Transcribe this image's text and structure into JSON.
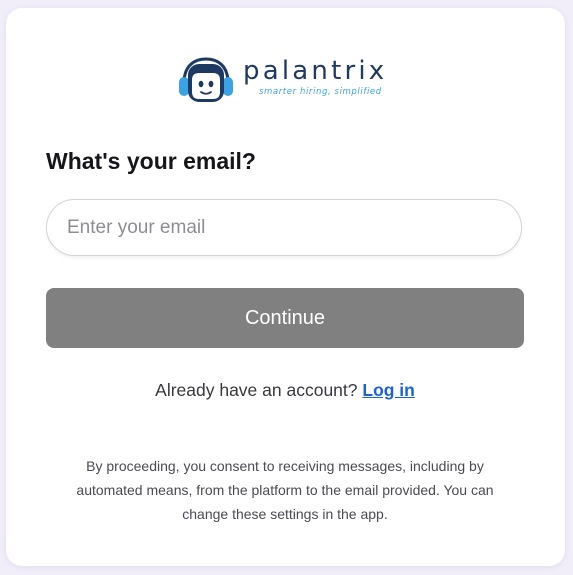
{
  "brand": {
    "name": "palantrix",
    "tagline": "smarter hiring, simplified",
    "logo_icon": "robot-headset-icon",
    "colors": {
      "primary_dark": "#1e3a62",
      "accent": "#3aa3e6"
    }
  },
  "form": {
    "heading": "What's your email?",
    "email_placeholder": "Enter your email",
    "email_value": "",
    "continue_label": "Continue",
    "continue_color": "#808080"
  },
  "account": {
    "prompt": "Already have an account?",
    "login_label": "Log in",
    "link_color": "#1a62d6"
  },
  "consent": {
    "lines": [
      "By proceeding, you consent to receiving messages, including by",
      "automated means, from the platform to the email provided. You can",
      "change these settings in the app."
    ]
  }
}
